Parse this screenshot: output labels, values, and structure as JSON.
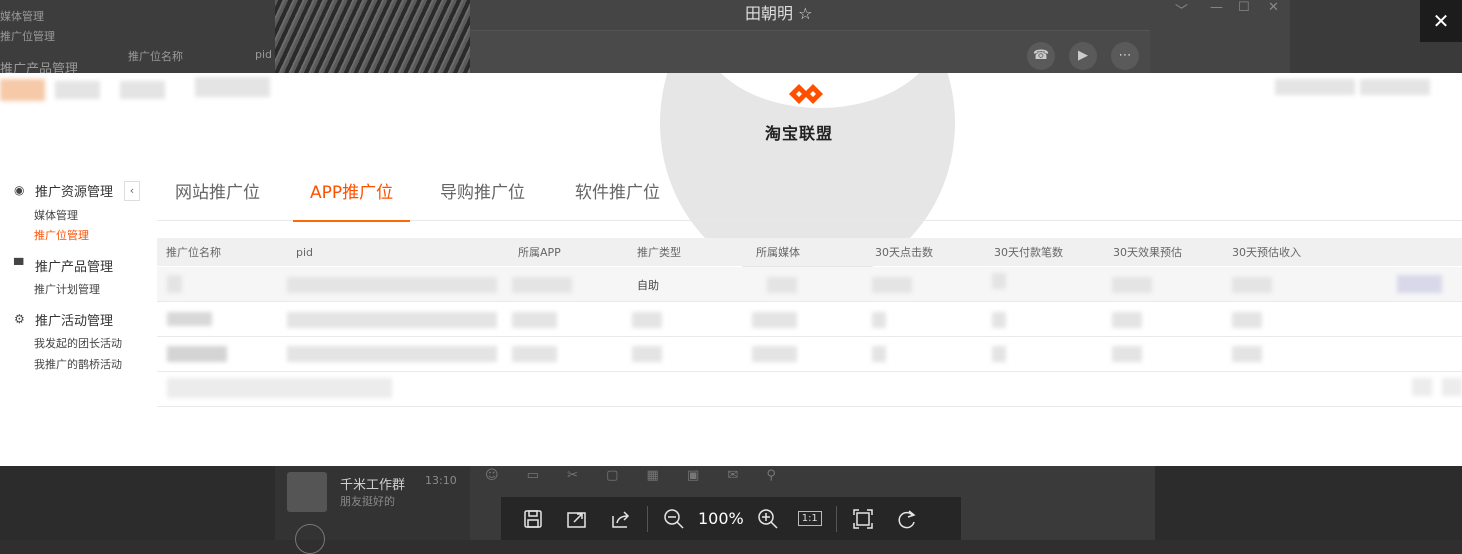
{
  "background_app": {
    "left_items": [
      "媒体管理",
      "推广位管理",
      "推广产品管理"
    ],
    "table_cols": [
      "推广位名称",
      "pid"
    ],
    "chat_name": "田朝明 ☆",
    "convo_title": "千米工作群",
    "convo_msg": "朋友挺好的",
    "convo_time": "13:10"
  },
  "viewer": {
    "close_label": "✕",
    "zoom": "100%",
    "ratio_label": "1:1"
  },
  "shot": {
    "brand": "淘宝联盟",
    "sidebar": {
      "groups": [
        {
          "label": "推广资源管理",
          "items": [
            "媒体管理",
            "推广位管理"
          ]
        },
        {
          "label": "推广产品管理",
          "items": [
            "推广计划管理"
          ]
        },
        {
          "label": "推广活动管理",
          "items": [
            "我发起的团长活动",
            "我推广的鹊桥活动"
          ]
        }
      ]
    },
    "tabs": [
      "网站推广位",
      "APP推广位",
      "导购推广位",
      "软件推广位"
    ],
    "active_tab": "APP推广位",
    "table": {
      "headers": [
        "推广位名称",
        "pid",
        "所属APP",
        "推广类型",
        "所属媒体",
        "30天点击数",
        "30天付款笔数",
        "30天效果预估",
        "30天预估收入"
      ],
      "row1_type": "自助"
    }
  },
  "colors": {
    "accent": "#ff5000",
    "overlay": "#2f2f2f"
  }
}
